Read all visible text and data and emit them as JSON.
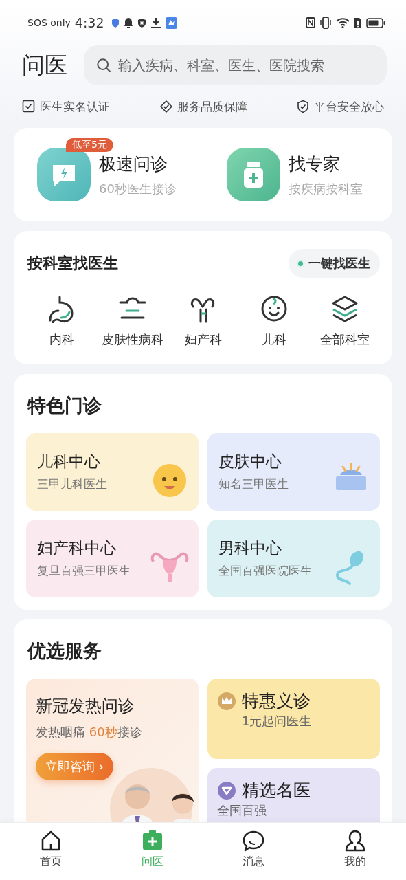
{
  "status_bar": {
    "carrier": "SOS only",
    "time": "4:32"
  },
  "header": {
    "title": "问医",
    "search": {
      "placeholder": "输入疾病、科室、医生、医院搜索"
    }
  },
  "guarantees": [
    {
      "kind": "checkbox",
      "label": "医生实名认证"
    },
    {
      "kind": "diamond",
      "label": "服务品质保障"
    },
    {
      "kind": "shield",
      "label": "平台安全放心"
    }
  ],
  "quick_services": [
    {
      "kind": "chat",
      "title": "极速问诊",
      "subtitle": "60秒医生接诊",
      "tag": "低至5元"
    },
    {
      "kind": "medicine",
      "title": "找专家",
      "subtitle": "按疾病按科室"
    }
  ],
  "departments": {
    "title": "按科室找医生",
    "action": "一键找医生",
    "items": [
      {
        "kind": "stomach",
        "label": "内科"
      },
      {
        "kind": "skin",
        "label": "皮肤性病科"
      },
      {
        "kind": "uterus",
        "label": "妇产科"
      },
      {
        "kind": "baby",
        "label": "儿科"
      },
      {
        "kind": "layers",
        "label": "全部科室"
      }
    ]
  },
  "specialty": {
    "title": "特色门诊",
    "cards": [
      {
        "kind": "baby",
        "title": "儿科中心",
        "subtitle": "三甲儿科医生",
        "color": "#fdf1d3"
      },
      {
        "kind": "skin",
        "title": "皮肤中心",
        "subtitle": "知名三甲医生",
        "color": "#e6ebfb"
      },
      {
        "kind": "uterus",
        "title": "妇产科中心",
        "subtitle": "复旦百强三甲医生",
        "color": "#fbe9f0"
      },
      {
        "kind": "sperm",
        "title": "男科中心",
        "subtitle": "全国百强医院医生",
        "color": "#dcf1f4"
      }
    ]
  },
  "preferred": {
    "title": "优选服务",
    "featured": {
      "title": "新冠发热问诊",
      "subtitle_before": "发热咽痛 ",
      "subtitle_highlight": "60秒",
      "subtitle_after": "接诊",
      "button": "立即咨询 ›"
    },
    "items": [
      {
        "kind": "crown",
        "title": "特惠义诊",
        "subtitle": "1元起问医生",
        "color": "#fbe7a8"
      },
      {
        "kind": "heart",
        "title": "精选名医",
        "subtitle": "全国百强",
        "color": "#e6e3f7"
      }
    ]
  },
  "tab_bar": [
    {
      "kind": "home",
      "label": "首页",
      "selected": false
    },
    {
      "kind": "kit",
      "label": "问医",
      "selected": true
    },
    {
      "kind": "chat",
      "label": "消息",
      "selected": false
    },
    {
      "kind": "person",
      "label": "我的",
      "selected": false
    }
  ]
}
